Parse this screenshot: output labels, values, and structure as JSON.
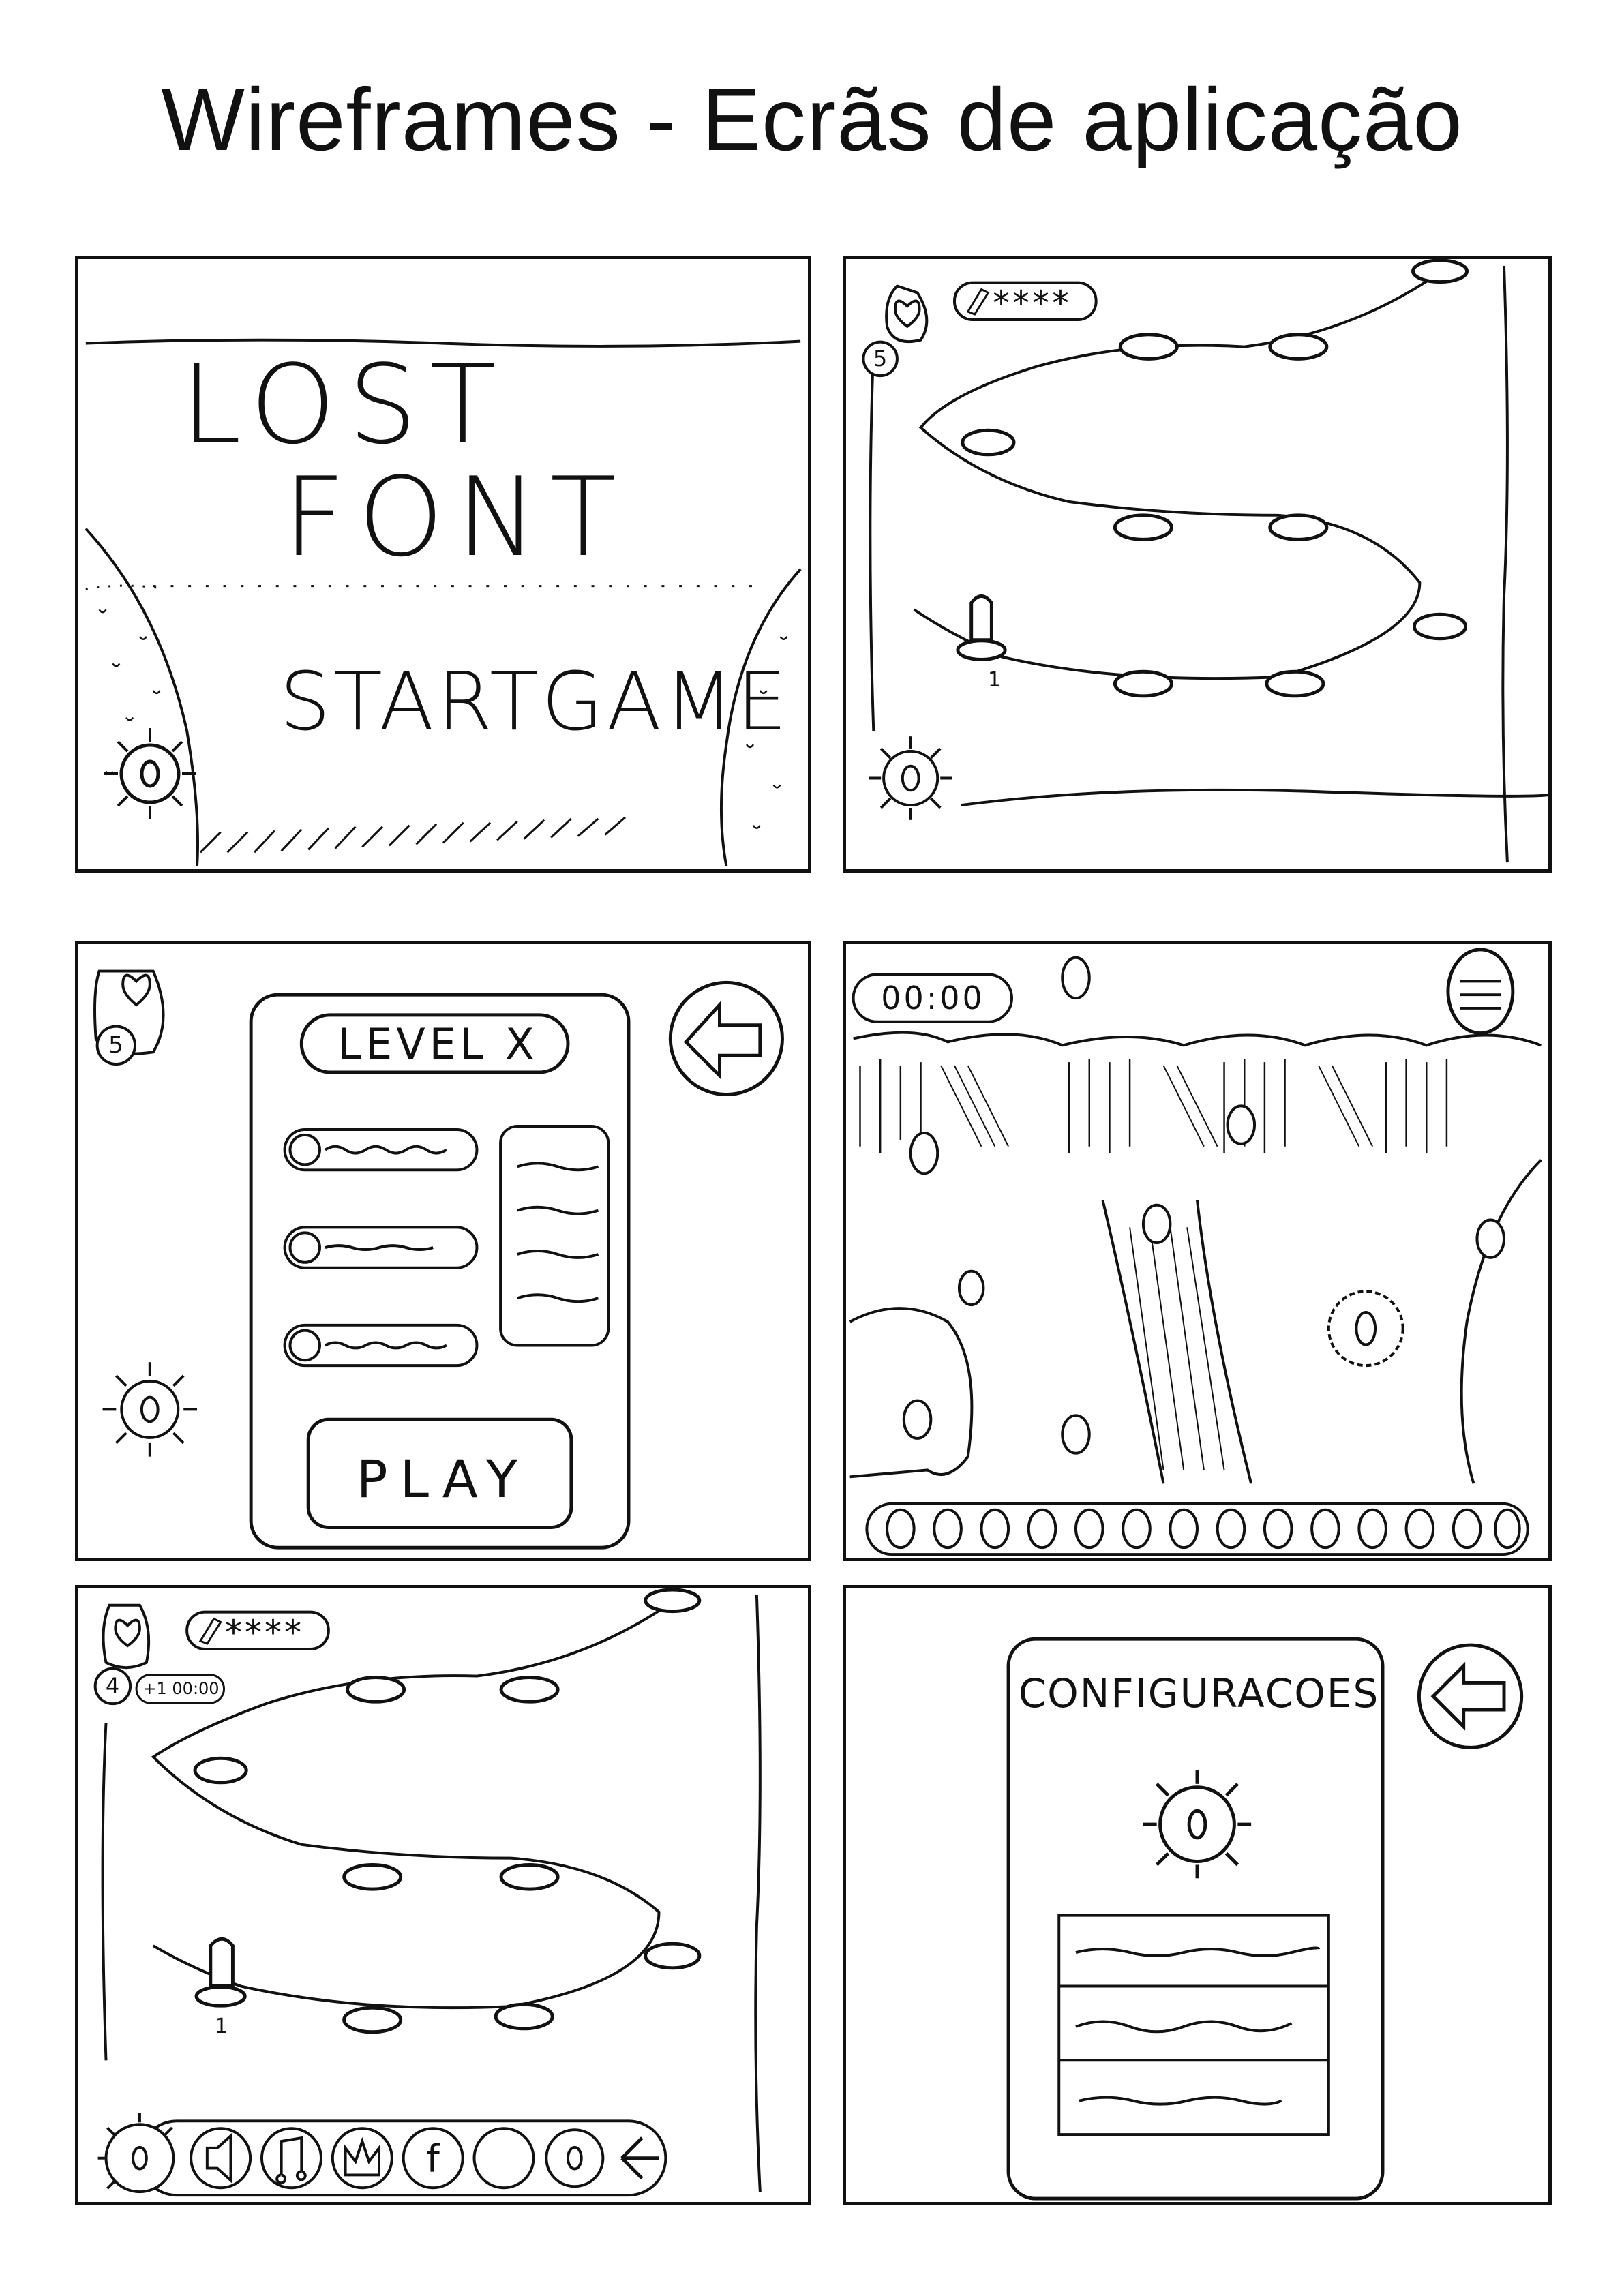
{
  "title": "Wireframes - Ecrãs de aplicação",
  "screen1": {
    "logo_line1": "LOST",
    "logo_line2": "FONT",
    "start_label": "STARTGAME"
  },
  "screen2": {
    "lives": "5",
    "stars": "****",
    "start_node_label": "1"
  },
  "screen3": {
    "lives": "5",
    "level_title": "LEVEL X",
    "play_label": "PLAY"
  },
  "screen4": {
    "timer": "00:00"
  },
  "screen5": {
    "lives": "4",
    "stars": "****",
    "bonus_timer": "+1 00:00",
    "start_node_label": "1"
  },
  "screen6": {
    "settings_title": "CONFIGURACOES"
  },
  "icons": [
    "heart-icon",
    "pencil-icon",
    "gear-icon",
    "back-arrow-icon",
    "sound-icon",
    "music-icon",
    "crown-icon",
    "facebook-icon"
  ],
  "colors": {
    "ink": "#111111",
    "paper": "#ffffff"
  }
}
